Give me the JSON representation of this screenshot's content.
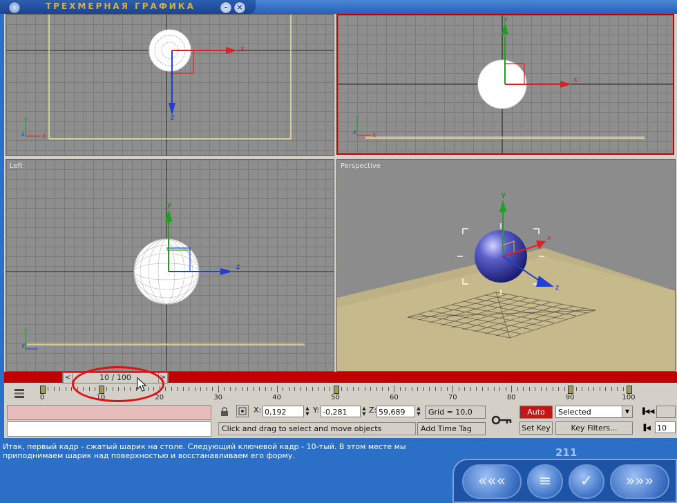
{
  "window": {
    "title": "ТРЕХМЕРНАЯ ГРАФИКА",
    "minimize": "–",
    "close": "×"
  },
  "viewports": {
    "top_left": {
      "label": ""
    },
    "top_right": {
      "label": ""
    },
    "left": {
      "label": "Left"
    },
    "perspective": {
      "label": "Perspective"
    }
  },
  "axes": {
    "x": "x",
    "y": "y",
    "z": "z"
  },
  "timeline": {
    "frame": "10 / 100",
    "prev": "<",
    "next": ">",
    "ticks": [
      "0",
      "10",
      "20",
      "30",
      "40",
      "50",
      "60",
      "70",
      "80",
      "90",
      "100"
    ]
  },
  "toolbar": {
    "x_label": "X:",
    "x_value": "0,192",
    "y_label": "Y:",
    "y_value": "-0,281",
    "z_label": "Z:",
    "z_value": "59,689",
    "grid": "Grid = 10,0",
    "status_prompt": "Click and drag to select and move objects",
    "add_time_tag": "Add Time Tag",
    "auto_key": "Auto Key",
    "set_key": "Set Key",
    "selected": "Selected",
    "key_filters": "Key Filters...",
    "spinner_right": "10"
  },
  "lesson": {
    "text": "Итак, первый кадр - сжатый шарик на столе. Следующий ключевой кадр - 10-тый. В этом месте мы приподнимаем шарик над поверхностью и восстанавливаем его форму.",
    "page": "211"
  },
  "colors": {
    "accent_red": "#c00000",
    "frame_blue": "#2b6fc7",
    "viewport_gray": "#8e8e8e"
  }
}
